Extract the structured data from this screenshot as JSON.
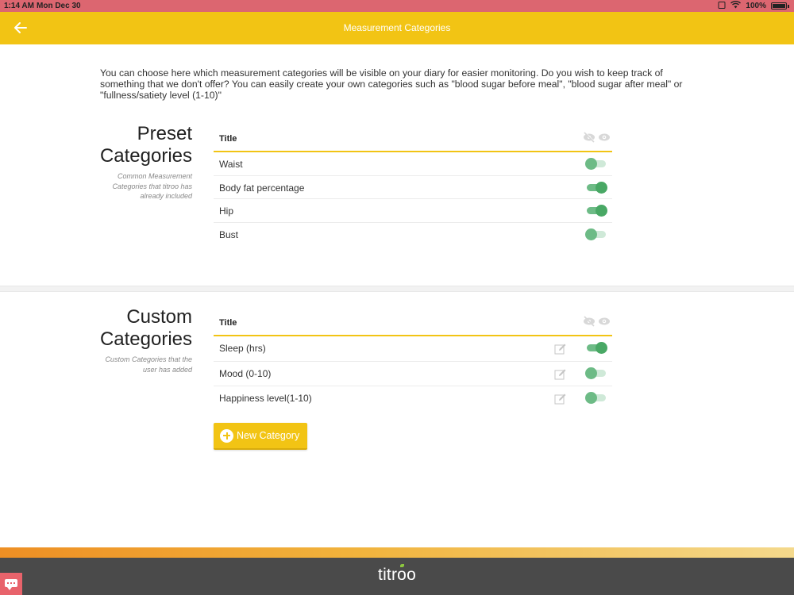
{
  "status_bar": {
    "time": "1:14 AM",
    "date": "Mon Dec 30",
    "battery": "100%"
  },
  "header": {
    "title": "Measurement Categories"
  },
  "intro_text": "You can choose here which measurement categories will be visible on your diary for easier monitoring. Do you wish to keep track of something that we don't offer? You can easily create your own categories such as \"blood sugar before meal\", \"blood sugar after meal\" or \"fullness/satiety level (1-10)\"",
  "preset": {
    "title_line1": "Preset",
    "title_line2": "Categories",
    "subtitle": "Common Measurement Categories that titroo has already included",
    "column_title": "Title",
    "rows": [
      {
        "label": "Waist",
        "visible": false
      },
      {
        "label": "Body fat percentage",
        "visible": true
      },
      {
        "label": "Hip",
        "visible": true
      },
      {
        "label": "Bust",
        "visible": false
      }
    ]
  },
  "custom": {
    "title_line1": "Custom",
    "title_line2": "Categories",
    "subtitle": "Custom Categories that the user has added",
    "column_title": "Title",
    "rows": [
      {
        "label": "Sleep (hrs)",
        "visible": true
      },
      {
        "label": "Mood (0-10)",
        "visible": false
      },
      {
        "label": "Happiness level(1-10)",
        "visible": false
      }
    ],
    "new_button_label": "New Category"
  },
  "footer": {
    "logo_prefix": "titr",
    "logo_o": "o",
    "logo_suffix": "o"
  },
  "colors": {
    "accent": "#f2c414",
    "status_bar": "#dc6670",
    "toggle_green": "#49a865",
    "footer": "#4a4a4a"
  },
  "icons": {
    "back": "arrow-left-icon",
    "hidden": "eye-slash-icon",
    "visible": "eye-icon",
    "edit": "pencil-edit-icon",
    "add": "plus-circle-icon",
    "chat": "chat-bubble-icon"
  }
}
